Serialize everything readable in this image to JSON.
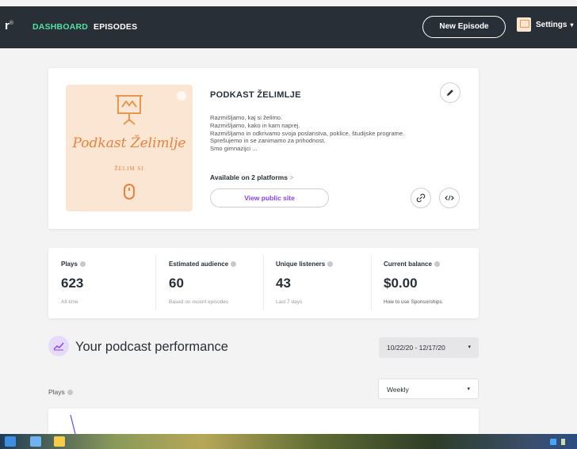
{
  "nav": {
    "logo_fragment": "r",
    "logo_mark": "®",
    "dashboard": "DASHBOARD",
    "episodes": "EPISODES",
    "new_episode": "New Episode",
    "settings": "Settings",
    "settings_chevron": "▾"
  },
  "podcast": {
    "cover_title": "Podkast Želimlje",
    "cover_subtitle": "ŽELIM SI",
    "title": "PODKAST ŽELIMLJE",
    "description": [
      "Razmišljamo, kaj si želimo.",
      "Razmišljamo, kako in kam naprej.",
      "Razmišljamo in odkrivamo svoja poslanstva, poklice, študijske programe.",
      "Sprešujemo in se zanimamo za prihodnost.",
      "Smo gimnazijci ..."
    ],
    "platforms": "Available on 2 platforms",
    "platforms_arrow": ">",
    "view_public_site": "View public site"
  },
  "stats": [
    {
      "label": "Plays",
      "value": "623",
      "sub": "All-time"
    },
    {
      "label": "Estimated audience",
      "value": "60",
      "sub": "Based on recent episodes"
    },
    {
      "label": "Unique listeners",
      "value": "43",
      "sub": "Last 7 days"
    },
    {
      "label": "Current balance",
      "value": "$0.00",
      "sub": "How to use Sponsorships"
    }
  ],
  "performance": {
    "title": "Your podcast performance",
    "date_range": "10/22/20 - 12/17/20",
    "select_chevron": "▾",
    "plays_label": "Plays",
    "interval": "Weekly"
  },
  "colors": {
    "nav_bg": "#292f36",
    "accent_green": "#53e0a5",
    "accent_purple": "#8940fa",
    "cover_bg": "#fbe5d3",
    "cover_orange": "#e8823f"
  },
  "icons": {
    "edit": "pencil-icon",
    "link": "link-icon",
    "embed": "code-icon",
    "chart": "line-chart-icon",
    "info": "info-icon"
  }
}
